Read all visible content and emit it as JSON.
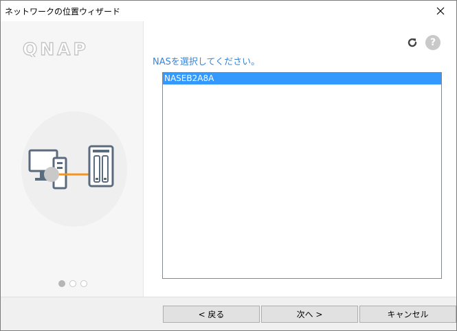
{
  "window": {
    "title": "ネットワークの位置ウィザード"
  },
  "brand": {
    "logo_text": "QNAP"
  },
  "wizard": {
    "steps_total": 3,
    "current_step": 1
  },
  "content": {
    "prompt": "NASを選択してください。",
    "nas_list": [
      {
        "name": "NASEB2A8A",
        "selected": true
      }
    ]
  },
  "buttons": {
    "back": "< 戻る",
    "next": "次へ >",
    "cancel": "キャンセル"
  },
  "icons": {
    "close": "close-icon",
    "refresh": "refresh-icon",
    "help": "help-icon",
    "help_glyph": "?"
  },
  "colors": {
    "prompt_text": "#3a85d6",
    "selection": "#3399ff",
    "connector_orange": "#f7941d",
    "device_gray": "#5a6b7e"
  }
}
